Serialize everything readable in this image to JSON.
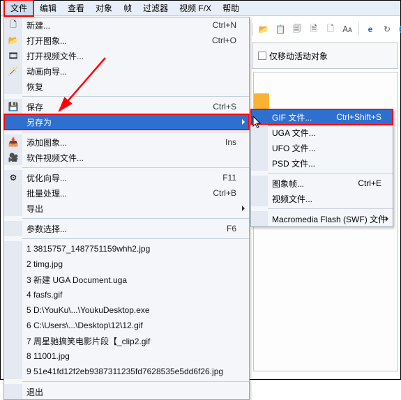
{
  "menubar": {
    "items": [
      "文件",
      "编辑",
      "查看",
      "对象",
      "帧",
      "过滤器",
      "视频 F/X",
      "帮助"
    ]
  },
  "right_toolbar_icons": [
    "open-icon",
    "paste-icon",
    "copy-icon",
    "doc-icon",
    "new-icon",
    "text-icon",
    "ie-icon",
    "redo-icon",
    "globe-icon"
  ],
  "right_panel": {
    "checkbox_label": "仅移动活动对象"
  },
  "dropdown": {
    "groups": [
      [
        {
          "icon": "new-doc-icon",
          "label": "新建...",
          "shortcut": "Ctrl+N"
        },
        {
          "icon": "open-img-icon",
          "label": "打开图象...",
          "shortcut": "Ctrl+O"
        },
        {
          "icon": "open-video-icon",
          "label": "打开视频文件..."
        },
        {
          "icon": "anim-wiz-icon",
          "label": "动画向导..."
        },
        {
          "icon": "",
          "label": "恢复"
        }
      ],
      [
        {
          "icon": "save-icon",
          "label": "保存",
          "shortcut": "Ctrl+S"
        },
        {
          "icon": "",
          "label": "另存为",
          "arrow": true,
          "highlight": true,
          "redbox": true
        }
      ],
      [
        {
          "icon": "add-img-icon",
          "label": "添加图象...",
          "shortcut": "Ins"
        },
        {
          "icon": "sw-video-icon",
          "label": "软件视频文件..."
        }
      ],
      [
        {
          "icon": "optimize-icon",
          "label": "优化向导...",
          "shortcut": "F11"
        },
        {
          "icon": "",
          "label": "批量处理...",
          "shortcut": "Ctrl+B"
        },
        {
          "icon": "",
          "label": "导出",
          "arrow": true
        }
      ],
      [
        {
          "icon": "",
          "label": "参数选择...",
          "shortcut": "F6"
        }
      ],
      [
        {
          "icon": "",
          "label": "1 3815757_1487751159whh2.jpg"
        },
        {
          "icon": "",
          "label": "2 timg.jpg"
        },
        {
          "icon": "",
          "label": "3 新建 UGA Document.uga"
        },
        {
          "icon": "",
          "label": "4 fasfs.gif"
        },
        {
          "icon": "",
          "label": "5 D:\\YouKu\\...\\YoukuDesktop.exe"
        },
        {
          "icon": "",
          "label": "6 C:\\Users\\...\\Desktop\\12\\12.gif"
        },
        {
          "icon": "",
          "label": "7 周星驰搞笑电影片段【_clip2.gif"
        },
        {
          "icon": "",
          "label": "8 11001.jpg"
        },
        {
          "icon": "",
          "label": "9 51e41fd12f2eb9387311235fd7628535e5dd6f26.jpg"
        }
      ],
      [
        {
          "icon": "",
          "label": "退出"
        }
      ]
    ]
  },
  "submenu": {
    "groups": [
      [
        {
          "label": "GIF 文件...",
          "shortcut": "Ctrl+Shift+S",
          "highlight": true,
          "redbox": true
        },
        {
          "label": "UGA 文件..."
        },
        {
          "label": "UFO 文件..."
        },
        {
          "label": "PSD 文件..."
        }
      ],
      [
        {
          "label": "图象帧...",
          "shortcut": "Ctrl+E"
        },
        {
          "label": "视频文件..."
        }
      ],
      [
        {
          "label": "Macromedia Flash (SWF) 文件",
          "arrow": true
        }
      ]
    ]
  }
}
